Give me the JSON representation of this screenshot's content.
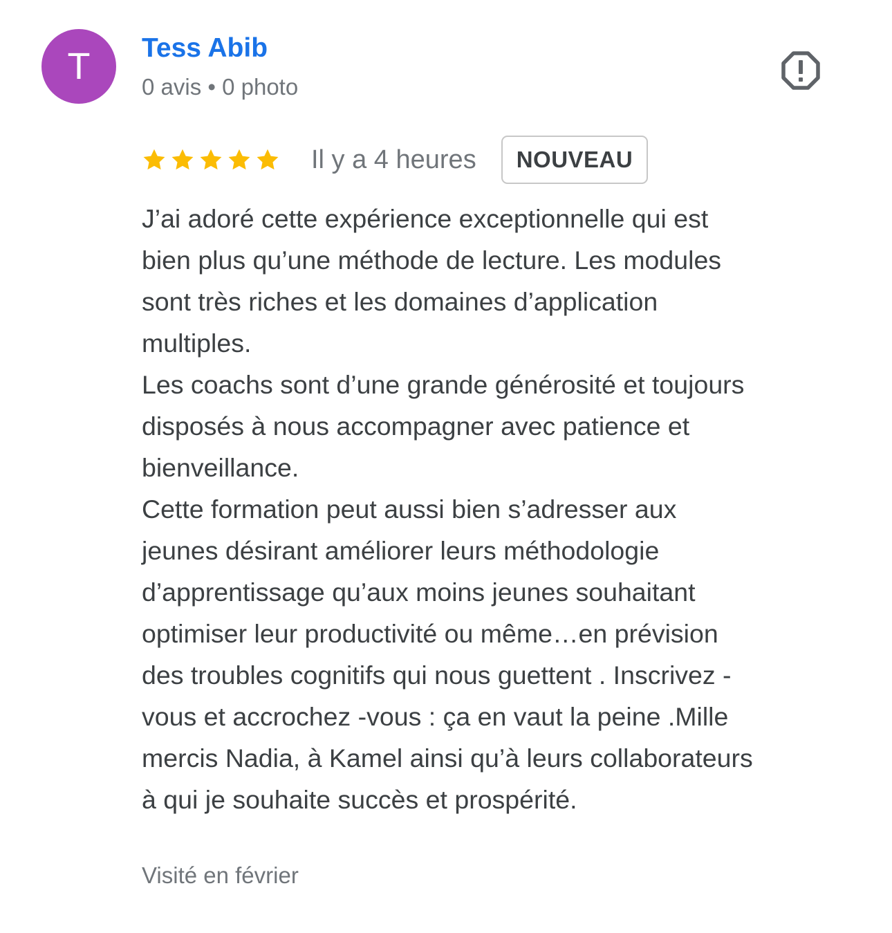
{
  "author": {
    "initial": "T",
    "name": "Tess Abib",
    "meta": "0 avis • 0 photo",
    "avatar_color": "#aa47bc",
    "name_color": "#1a73e8"
  },
  "report": {
    "icon": "report-octagon-icon"
  },
  "rating": {
    "stars": 5,
    "max": 5,
    "star_color": "#fbbc04",
    "time": "Il y a 4 heures",
    "badge": "NOUVEAU"
  },
  "review": {
    "lines": [
      "J’ai adoré cette expérience exceptionnelle qui est",
      "bien plus qu’une méthode de lecture. Les modules",
      "sont très riches et les domaines d’application",
      "multiples.",
      "Les coachs sont d’une grande générosité et toujours",
      "disposés à nous accompagner avec patience et",
      "bienveillance.",
      "Cette formation peut aussi bien s’adresser aux",
      "jeunes désirant améliorer leurs méthodologie",
      "d’apprentissage qu’aux moins jeunes souhaitant",
      "optimiser leur productivité ou même…en prévision",
      "des troubles cognitifs qui nous guettent . Inscrivez -",
      "vous et accrochez -vous : ça en vaut la peine .Mille",
      "mercis Nadia, à Kamel ainsi qu’à leurs collaborateurs",
      "à qui je souhaite succès et prospérité."
    ]
  },
  "visited": "Visité en février"
}
